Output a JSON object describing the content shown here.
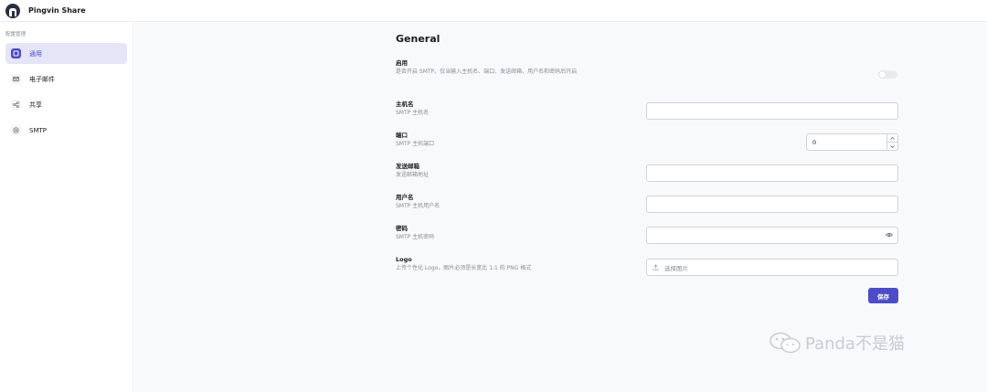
{
  "app": {
    "title": "Pingvin Share"
  },
  "sidebar": {
    "heading": "配置管理",
    "items": [
      {
        "label": "通用",
        "icon": "square-icon",
        "active": true
      },
      {
        "label": "电子邮件",
        "icon": "mail-icon",
        "active": false
      },
      {
        "label": "共享",
        "icon": "share-icon",
        "active": false
      },
      {
        "label": "SMTP",
        "icon": "at-icon",
        "active": false
      }
    ]
  },
  "main": {
    "title": "General",
    "fields": {
      "enable": {
        "label": "启用",
        "desc": "是否开启 SMTP。仅当输入主机名、端口、发送邮箱、用户名和密码后开启",
        "value": false
      },
      "host": {
        "label": "主机名",
        "desc": "SMTP 主机名",
        "value": ""
      },
      "port": {
        "label": "端口",
        "desc": "SMTP 主机端口",
        "value": "0"
      },
      "from": {
        "label": "发送邮箱",
        "desc": "发送邮箱地址",
        "value": ""
      },
      "username": {
        "label": "用户名",
        "desc": "SMTP 主机用户名",
        "value": ""
      },
      "password": {
        "label": "密码",
        "desc": "SMTP 主机密码",
        "value": ""
      },
      "logo": {
        "label": "Logo",
        "desc": "上传个性化 Logo，图片必须是长宽比 1:1 的 PNG 格式",
        "placeholder": "选择图片"
      }
    },
    "save_label": "保存"
  },
  "watermark": {
    "text": "Panda不是猫"
  },
  "colors": {
    "accent": "#4c4cc8",
    "active_bg": "#e5e5f7",
    "background": "#f8f9fa"
  }
}
